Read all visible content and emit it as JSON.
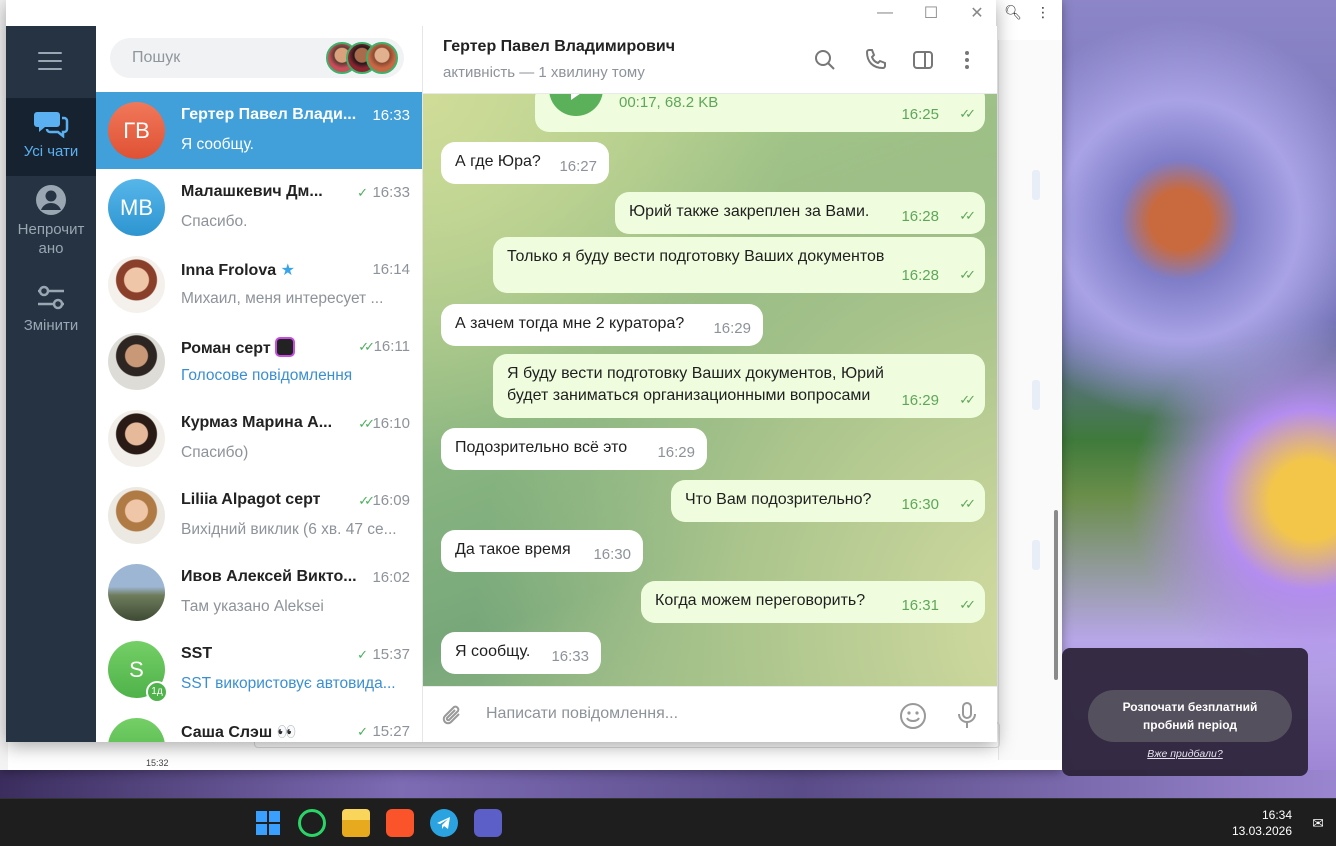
{
  "search": {
    "placeholder": "Пошук"
  },
  "rail": {
    "all_chats": "Усі чати",
    "unread_line1": "Непрочит",
    "unread_line2": "ано",
    "edit": "Змінити"
  },
  "chats": [
    {
      "name": "Гертер Павел Влади...",
      "time": "16:33",
      "msg": "Я сообщу.",
      "avatar_text": "ГВ",
      "avatar_color": "#e5613f",
      "active": true
    },
    {
      "name": "Малашкевич Дм...",
      "time": "16:33",
      "msg": "Спасибо.",
      "avatar_text": "МВ",
      "avatar_color": "#3aa4d9",
      "read": true
    },
    {
      "name": "Inna Frolova",
      "time": "16:14",
      "msg": "Михаил,  меня интересует ..."
    },
    {
      "name": "Роман серт",
      "time": "16:11",
      "msg": "Голосове повідомлення",
      "read": true
    },
    {
      "name": "Курмаз Марина А...",
      "time": "16:10",
      "msg": "Спасибо)",
      "read": true
    },
    {
      "name": "Liliia Alpagot серт",
      "time": "16:09",
      "msg": "Вихідний виклик (6 хв. 47 се...",
      "read": true
    },
    {
      "name": "Ивов Алексей Викто...",
      "time": "16:02",
      "msg": "Там указано Aleksei"
    },
    {
      "name": "SST",
      "time": "15:37",
      "msg": "SST використовує автовида...",
      "avatar_text": "S",
      "avatar_color": "#64c25a",
      "badge": "1д",
      "read": true
    },
    {
      "name": "Саша Слэш 👀",
      "time": "15:27",
      "msg": "",
      "avatar_color": "#64c25a",
      "read": true
    }
  ],
  "conversation": {
    "name": "Гертер Павел Владимирович",
    "status": "активність — 1 хвилину тому",
    "voice": {
      "meta": "00:17, 68.2 KB",
      "time": "16:25"
    },
    "messages": [
      {
        "dir": "in",
        "text": "А где Юра?",
        "time": "16:27"
      },
      {
        "dir": "out",
        "text": "Юрий также закреплен за Вами.",
        "time": "16:28"
      },
      {
        "dir": "out",
        "text": "Только я буду вести подготовку Ваших документов",
        "time": "16:28"
      },
      {
        "dir": "in",
        "text": "А зачем тогда мне 2 куратора?",
        "time": "16:29"
      },
      {
        "dir": "out",
        "text": "Я буду вести подготовку Ваших документов, Юрий будет заниматься организационными вопросами",
        "time": "16:29"
      },
      {
        "dir": "in",
        "text": "Подозрительно всё это",
        "time": "16:29"
      },
      {
        "dir": "out",
        "text": "Что Вам подозрительно?",
        "time": "16:30"
      },
      {
        "dir": "in",
        "text": "Да такое время",
        "time": "16:30"
      },
      {
        "dir": "out",
        "text": "Когда можем переговорить?",
        "time": "16:31"
      },
      {
        "dir": "in",
        "text": "Я сообщу.",
        "time": "16:33"
      }
    ],
    "composer_placeholder": "Написати повідомлення..."
  },
  "trial": {
    "button_line1": "Розпочати безплатний",
    "button_line2": "пробний період",
    "link": "Вже придбали?"
  },
  "background_window": {
    "time": "15:32"
  },
  "taskbar": {
    "time": "16:34",
    "date": "13.03.2026"
  }
}
